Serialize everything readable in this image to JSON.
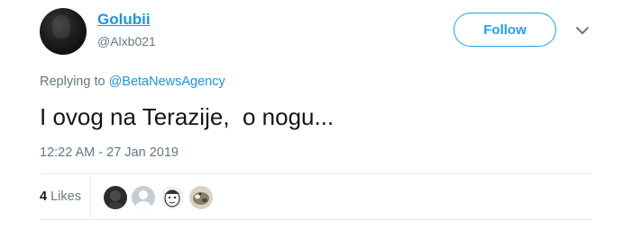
{
  "user": {
    "display_name": "Golubii",
    "handle": "@Alxb021",
    "avatar_icon": "profile-photo-dark"
  },
  "follow_button": {
    "label": "Follow",
    "color": "#1da1f2"
  },
  "menu_icon": "chevron-down-icon",
  "reply_context": {
    "prefix": "Replying to",
    "mention": "@BetaNewsAgency"
  },
  "tweet": {
    "text": "I ovog na Terazije,  o nogu...",
    "timestamp": "12:22 AM - 27 Jan 2019"
  },
  "likes": {
    "count": "4",
    "label": "Likes",
    "avatars": [
      "liker-avatar-dark",
      "liker-avatar-default-grey",
      "liker-avatar-cartoon-face",
      "liker-avatar-animal"
    ]
  },
  "colors": {
    "link": "#1b95e0",
    "muted": "#657786",
    "text": "#14171a",
    "divider": "#e6ecf0"
  }
}
